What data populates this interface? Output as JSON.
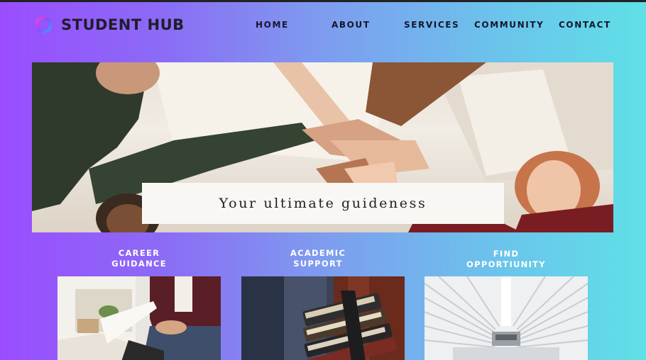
{
  "header": {
    "brand": "STUDENT HUB",
    "nav": [
      "HOME",
      "ABOUT",
      "SERVICES",
      "COMMUNITY",
      "CONTACT"
    ]
  },
  "hero": {
    "caption": "Your ultimate guideness"
  },
  "cards": [
    {
      "line1": "CAREER",
      "line2": "GUIDANCE"
    },
    {
      "line1": "ACADEMIC",
      "line2": "SUPPORT"
    },
    {
      "line1": "FIND",
      "line2": "OPPORTIUNITY"
    }
  ],
  "colors": {
    "gradient_start": "#9a4dff",
    "gradient_end": "#5fe0e6",
    "brand_text": "#1e1e2a",
    "card_title": "#ffffff"
  }
}
